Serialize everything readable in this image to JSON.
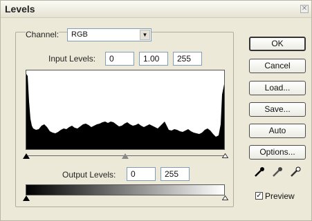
{
  "window": {
    "title": "Levels"
  },
  "channel": {
    "label": "Channel:",
    "value": "RGB"
  },
  "input_levels": {
    "label": "Input Levels:",
    "black": "0",
    "gamma": "1.00",
    "white": "255"
  },
  "output_levels": {
    "label": "Output Levels:",
    "black": "0",
    "white": "255"
  },
  "buttons": {
    "ok": "OK",
    "cancel": "Cancel",
    "load": "Load...",
    "save": "Save...",
    "auto": "Auto",
    "options": "Options..."
  },
  "preview": {
    "label": "Preview",
    "checked": true
  },
  "colors": {
    "dialog_bg": "#ece9d8",
    "histogram_fill": "#000000"
  }
}
